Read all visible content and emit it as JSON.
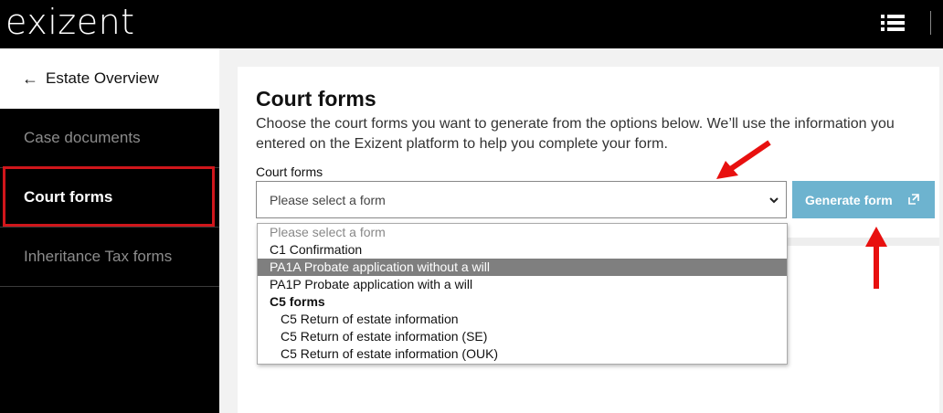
{
  "header": {
    "logo_text": "exizent",
    "menu_icon": "list-icon"
  },
  "sidebar": {
    "back_label": "Estate Overview",
    "back_icon": "arrow-left-icon",
    "items": [
      {
        "label": "Case documents",
        "active": false
      },
      {
        "label": "Court forms",
        "active": true
      },
      {
        "label": "Inheritance Tax forms",
        "active": false
      }
    ]
  },
  "main": {
    "title": "Court forms",
    "intro": "Choose the court forms you want to generate from the options below. We’ll use the information you entered on the Exizent platform to help you complete your form.",
    "field_label": "Court forms",
    "select_value": "Please select a form",
    "generate_label": "Generate form",
    "generate_icon": "external-link-icon"
  },
  "dropdown": {
    "options": [
      {
        "label": "Please select a form",
        "kind": "placeholder"
      },
      {
        "label": "C1 Confirmation",
        "kind": "option"
      },
      {
        "label": "PA1A Probate application without a will",
        "kind": "selected"
      },
      {
        "label": "PA1P Probate application with a will",
        "kind": "option"
      },
      {
        "label": "C5 forms",
        "kind": "group"
      },
      {
        "label": "C5 Return of estate information",
        "kind": "child"
      },
      {
        "label": "C5 Return of estate information (SE)",
        "kind": "child"
      },
      {
        "label": "C5 Return of estate information (OUK)",
        "kind": "child"
      }
    ]
  },
  "colors": {
    "accent_button": "#6db3cf",
    "highlight_red": "#d0161b",
    "annotation_arrow": "#e8100f"
  }
}
